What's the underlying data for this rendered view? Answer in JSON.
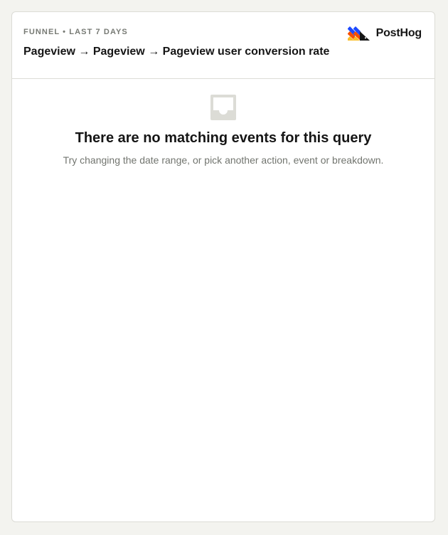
{
  "card": {
    "subtitle": "FUNNEL • LAST 7 DAYS",
    "title": "Pageview → Pageview → Pageview user conversion rate",
    "brand": {
      "name": "PostHog",
      "icon": "posthog-logo-icon",
      "colors": [
        "#1d4aff",
        "#f54e00",
        "#f9bd2b",
        "#151515"
      ]
    }
  },
  "empty_state": {
    "icon": "inbox-icon",
    "icon_color": "#dcdcd6",
    "title": "There are no matching events for this query",
    "description": "Try changing the date range, or pick another action, event or breakdown."
  }
}
